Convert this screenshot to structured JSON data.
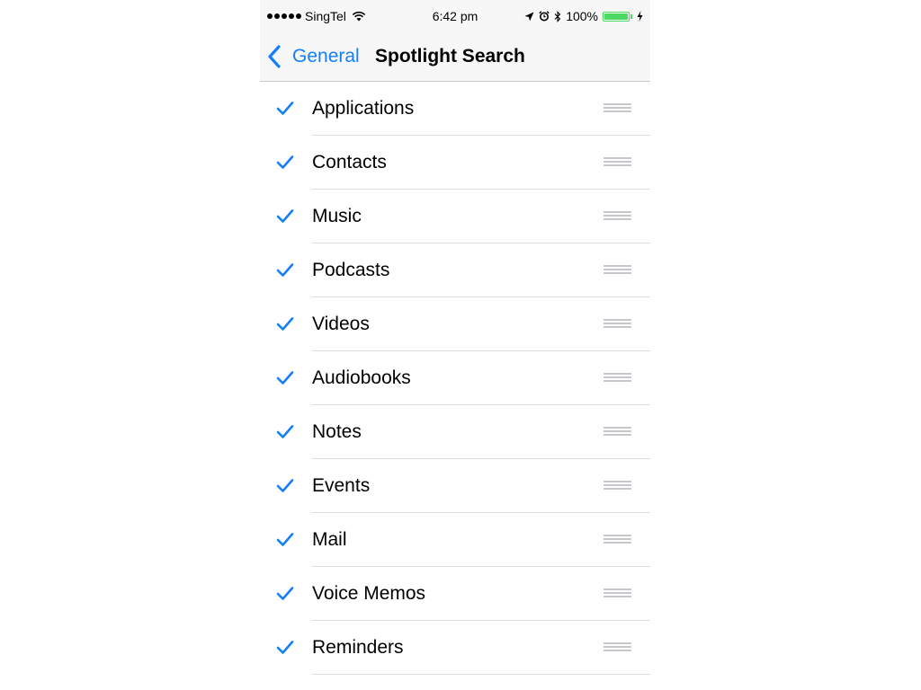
{
  "status_bar": {
    "carrier": "SingTel",
    "time": "6:42 pm",
    "battery": "100%",
    "battery_level": 1.0,
    "icons": [
      "signal-dots",
      "wifi-icon",
      "location-arrow-icon",
      "alarm-icon",
      "bluetooth-icon",
      "battery-icon",
      "charging-bolt-icon"
    ]
  },
  "nav": {
    "back_label": "General",
    "title": "Spotlight Search"
  },
  "list": {
    "items": [
      {
        "label": "Applications",
        "checked": true
      },
      {
        "label": "Contacts",
        "checked": true
      },
      {
        "label": "Music",
        "checked": true
      },
      {
        "label": "Podcasts",
        "checked": true
      },
      {
        "label": "Videos",
        "checked": true
      },
      {
        "label": "Audiobooks",
        "checked": true
      },
      {
        "label": "Notes",
        "checked": true
      },
      {
        "label": "Events",
        "checked": true
      },
      {
        "label": "Mail",
        "checked": true
      },
      {
        "label": "Voice Memos",
        "checked": true
      },
      {
        "label": "Reminders",
        "checked": true
      }
    ]
  },
  "colors": {
    "accent": "#157efb",
    "battery": "#4cd964",
    "grip": "#c7c7cc",
    "bar_background": "#f7f7f7"
  }
}
